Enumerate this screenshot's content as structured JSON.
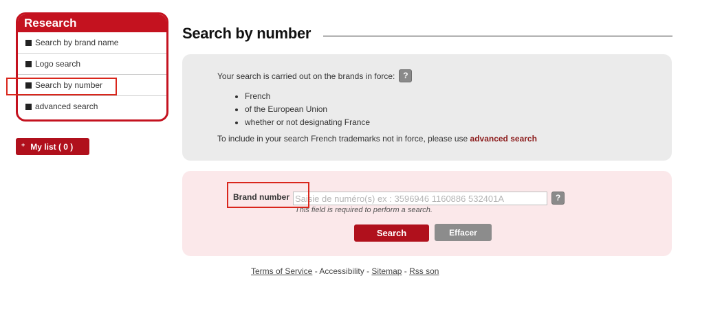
{
  "sidebar": {
    "title": "Research",
    "items": [
      {
        "label": "Search by brand name"
      },
      {
        "label": "Logo search"
      },
      {
        "label": "Search by number"
      },
      {
        "label": "advanced search"
      }
    ]
  },
  "mylist": {
    "plus": "+",
    "label": "My list ( 0 )"
  },
  "main": {
    "title": "Search by number",
    "info": {
      "intro": "Your search is carried out on the brands in force:",
      "help": "?",
      "bullets": [
        "French",
        "of the European Union",
        "whether or not designating France"
      ],
      "note_prefix": "To include in your search French trademarks not in force, please use ",
      "note_link": "advanced search"
    },
    "form": {
      "label": "Brand number",
      "placeholder": "Saisie de numéro(s) ex : 3596946 1160886 532401A",
      "value": "",
      "help": "?",
      "hint": "This field is required to perform a search.",
      "search_label": "Search",
      "clear_label": "Effacer"
    }
  },
  "footer": {
    "terms": "Terms of Service",
    "sep1": " - ",
    "accessibility": "Accessibility",
    "sep2": " - ",
    "sitemap": "Sitemap",
    "sep3": " - ",
    "rss": "Rss son"
  },
  "colors": {
    "brand_red": "#c4121f",
    "link_red": "#8b1a1a",
    "info_bg": "#ebebeb",
    "form_bg": "#fbe8ea"
  }
}
